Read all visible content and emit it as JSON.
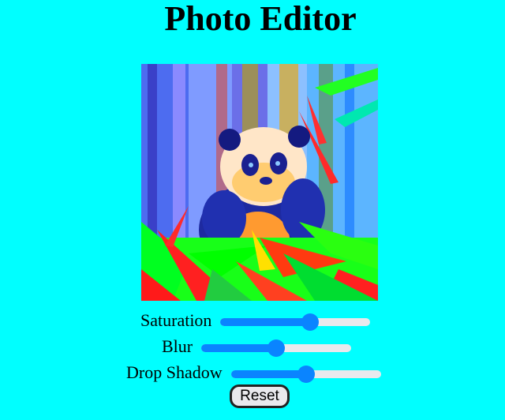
{
  "title": "Photo Editor",
  "image": {
    "alt": "panda",
    "icon": "panda-photo"
  },
  "controls": {
    "saturation": {
      "label": "Saturation",
      "value": 0.6
    },
    "blur": {
      "label": "Blur",
      "value": 0.5
    },
    "drop_shadow": {
      "label": "Drop Shadow",
      "value": 0.5
    }
  },
  "reset_label": "Reset",
  "colors": {
    "background": "#00FFFF",
    "slider_accent": "#0a84ff",
    "slider_track": "#e9e9ed"
  }
}
